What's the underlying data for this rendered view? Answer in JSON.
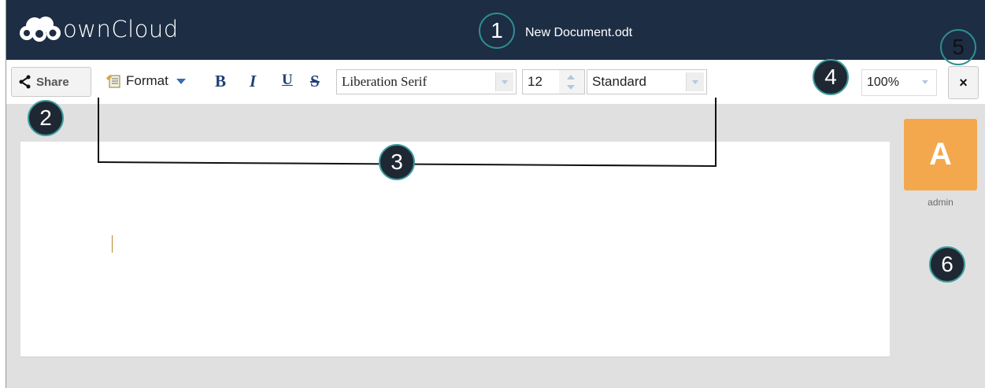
{
  "app": {
    "logo_text": "ownCloud",
    "document_title": "New Document.odt"
  },
  "toolbar": {
    "share_label": "Share",
    "format_label": "Format",
    "bold_label": "B",
    "italic_label": "I",
    "underline_label": "U",
    "strike_label": "S",
    "font_family": "Liberation Serif",
    "font_size": "12",
    "paragraph_style": "Standard",
    "zoom": "100%",
    "close_label": "×"
  },
  "user": {
    "avatar_letter": "A",
    "name": "admin"
  },
  "callouts": [
    "1",
    "2",
    "3",
    "4",
    "5",
    "6"
  ],
  "colors": {
    "header": "#1d2d44",
    "avatar": "#f3a84d",
    "callout_ring": "#2d8f8f",
    "workspace": "#e0e0e0"
  }
}
